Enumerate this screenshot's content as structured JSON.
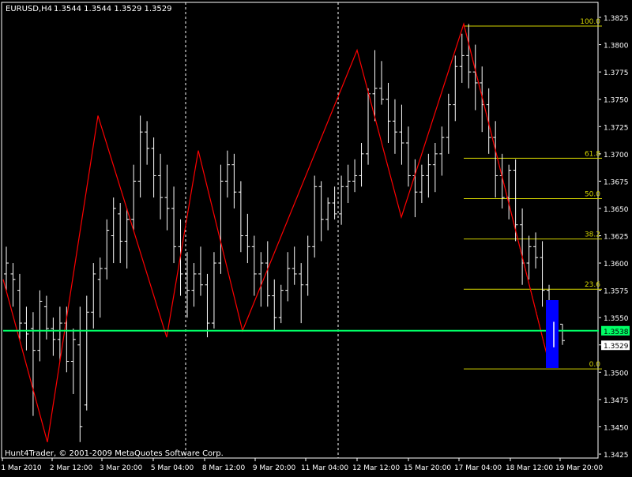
{
  "header": {
    "symbol_timeframe": "EURUSD,H4",
    "ohlc": "1.3544 1.3544 1.3529 1.3529"
  },
  "footer": {
    "copyright": "Hunt4Trader, © 2001-2009 MetaQuotes Software Corp."
  },
  "colors": {
    "background": "#000000",
    "frame": "#ffffff",
    "candle": "#ffffff",
    "zigzag": "#ff0000",
    "fib": "#d4d400",
    "hline": "#00ff66",
    "session_separator": "#ffffff",
    "blue_box": "#0000ff"
  },
  "chart_data": {
    "type": "candlestick",
    "symbol": "EURUSD",
    "timeframe": "H4",
    "ylim": [
      1.342,
      1.3835
    ],
    "y_ticks": [
      "1.3825",
      "1.3800",
      "1.3775",
      "1.3750",
      "1.3725",
      "1.3700",
      "1.3675",
      "1.3650",
      "1.3625",
      "1.3600",
      "1.3575",
      "1.3550",
      "1.3525",
      "1.3500",
      "1.3475",
      "1.3450",
      "1.3425"
    ],
    "x_ticks": [
      "1 Mar 2010",
      "2 Mar 12:00",
      "3 Mar 20:00",
      "5 Mar 04:00",
      "8 Mar 12:00",
      "9 Mar 20:00",
      "11 Mar 04:00",
      "12 Mar 12:00",
      "15 Mar 20:00",
      "17 Mar 04:00",
      "18 Mar 12:00",
      "19 Mar 20:00"
    ],
    "session_separators": [
      "5 Mar 04:00",
      "11 Mar 04:00"
    ],
    "current_price": {
      "label": "1.3538",
      "value": 1.3538
    },
    "bid_price": {
      "label": "1.3529",
      "value": 1.3529
    },
    "fibonacci": {
      "levels": [
        {
          "label": "100.0",
          "price": 1.3817
        },
        {
          "label": "61.8",
          "price": 1.3696
        },
        {
          "label": "50.0",
          "price": 1.3659
        },
        {
          "label": "38.2",
          "price": 1.3622
        },
        {
          "label": "23.6",
          "price": 1.3576
        },
        {
          "label": "0.0",
          "price": 1.3503
        }
      ]
    },
    "zigzag": [
      {
        "t": "1 Mar 2010",
        "price": 1.3585
      },
      {
        "t": "2 Mar 04:00",
        "price": 1.3436
      },
      {
        "t": "3 Mar 04:00",
        "price": 1.3735
      },
      {
        "t": "4 Mar 20:00",
        "price": 1.3532
      },
      {
        "t": "5 Mar 12:00",
        "price": 1.3703
      },
      {
        "t": "8 Mar 20:00",
        "price": 1.3538
      },
      {
        "t": "11 Mar 20:00",
        "price": 1.3795
      },
      {
        "t": "15 Mar 04:00",
        "price": 1.3642
      },
      {
        "t": "17 Mar 04:00",
        "price": 1.3819
      },
      {
        "t": "19 Mar 04:00",
        "price": 1.3505
      }
    ],
    "candles": [
      {
        "o": 1.359,
        "h": 1.3615,
        "l": 1.3575,
        "c": 1.36
      },
      {
        "o": 1.359,
        "h": 1.36,
        "l": 1.356,
        "c": 1.3585
      },
      {
        "o": 1.3575,
        "h": 1.359,
        "l": 1.353,
        "c": 1.3545
      },
      {
        "o": 1.3545,
        "h": 1.356,
        "l": 1.352,
        "c": 1.3535
      },
      {
        "o": 1.354,
        "h": 1.3555,
        "l": 1.346,
        "c": 1.352
      },
      {
        "o": 1.352,
        "h": 1.3575,
        "l": 1.351,
        "c": 1.3565
      },
      {
        "o": 1.356,
        "h": 1.357,
        "l": 1.353,
        "c": 1.354
      },
      {
        "o": 1.354,
        "h": 1.355,
        "l": 1.3515,
        "c": 1.353
      },
      {
        "o": 1.353,
        "h": 1.356,
        "l": 1.351,
        "c": 1.3545
      },
      {
        "o": 1.3545,
        "h": 1.356,
        "l": 1.35,
        "c": 1.351
      },
      {
        "o": 1.351,
        "h": 1.354,
        "l": 1.348,
        "c": 1.353
      },
      {
        "o": 1.3525,
        "h": 1.356,
        "l": 1.3436,
        "c": 1.345
      },
      {
        "o": 1.347,
        "h": 1.357,
        "l": 1.3465,
        "c": 1.3555
      },
      {
        "o": 1.3555,
        "h": 1.36,
        "l": 1.354,
        "c": 1.359
      },
      {
        "o": 1.3585,
        "h": 1.3605,
        "l": 1.355,
        "c": 1.3595
      },
      {
        "o": 1.3595,
        "h": 1.364,
        "l": 1.3585,
        "c": 1.363
      },
      {
        "o": 1.3625,
        "h": 1.366,
        "l": 1.36,
        "c": 1.365
      },
      {
        "o": 1.3645,
        "h": 1.3655,
        "l": 1.36,
        "c": 1.362
      },
      {
        "o": 1.362,
        "h": 1.365,
        "l": 1.3595,
        "c": 1.364
      },
      {
        "o": 1.364,
        "h": 1.369,
        "l": 1.363,
        "c": 1.3675
      },
      {
        "o": 1.3675,
        "h": 1.3735,
        "l": 1.366,
        "c": 1.372
      },
      {
        "o": 1.372,
        "h": 1.373,
        "l": 1.369,
        "c": 1.3705
      },
      {
        "o": 1.3705,
        "h": 1.3715,
        "l": 1.366,
        "c": 1.368
      },
      {
        "o": 1.368,
        "h": 1.37,
        "l": 1.364,
        "c": 1.366
      },
      {
        "o": 1.366,
        "h": 1.369,
        "l": 1.363,
        "c": 1.365
      },
      {
        "o": 1.365,
        "h": 1.367,
        "l": 1.36,
        "c": 1.3615
      },
      {
        "o": 1.3615,
        "h": 1.364,
        "l": 1.357,
        "c": 1.359
      },
      {
        "o": 1.359,
        "h": 1.361,
        "l": 1.355,
        "c": 1.3575
      },
      {
        "o": 1.3575,
        "h": 1.36,
        "l": 1.356,
        "c": 1.359
      },
      {
        "o": 1.359,
        "h": 1.3615,
        "l": 1.357,
        "c": 1.358
      },
      {
        "o": 1.358,
        "h": 1.359,
        "l": 1.3532,
        "c": 1.3545
      },
      {
        "o": 1.3545,
        "h": 1.361,
        "l": 1.354,
        "c": 1.36
      },
      {
        "o": 1.36,
        "h": 1.369,
        "l": 1.359,
        "c": 1.3675
      },
      {
        "o": 1.3675,
        "h": 1.3703,
        "l": 1.366,
        "c": 1.369
      },
      {
        "o": 1.369,
        "h": 1.37,
        "l": 1.365,
        "c": 1.3665
      },
      {
        "o": 1.3665,
        "h": 1.3675,
        "l": 1.361,
        "c": 1.3625
      },
      {
        "o": 1.3625,
        "h": 1.3645,
        "l": 1.36,
        "c": 1.3615
      },
      {
        "o": 1.3615,
        "h": 1.3625,
        "l": 1.357,
        "c": 1.359
      },
      {
        "o": 1.359,
        "h": 1.361,
        "l": 1.356,
        "c": 1.36
      },
      {
        "o": 1.36,
        "h": 1.362,
        "l": 1.356,
        "c": 1.357
      },
      {
        "o": 1.357,
        "h": 1.3585,
        "l": 1.3538,
        "c": 1.355
      },
      {
        "o": 1.355,
        "h": 1.358,
        "l": 1.3545,
        "c": 1.3575
      },
      {
        "o": 1.3575,
        "h": 1.361,
        "l": 1.3565,
        "c": 1.3595
      },
      {
        "o": 1.3595,
        "h": 1.3615,
        "l": 1.358,
        "c": 1.359
      },
      {
        "o": 1.359,
        "h": 1.36,
        "l": 1.3545,
        "c": 1.358
      },
      {
        "o": 1.358,
        "h": 1.3625,
        "l": 1.357,
        "c": 1.3615
      },
      {
        "o": 1.3615,
        "h": 1.368,
        "l": 1.3605,
        "c": 1.367
      },
      {
        "o": 1.367,
        "h": 1.3675,
        "l": 1.362,
        "c": 1.364
      },
      {
        "o": 1.364,
        "h": 1.366,
        "l": 1.363,
        "c": 1.3655
      },
      {
        "o": 1.3655,
        "h": 1.367,
        "l": 1.364,
        "c": 1.3645
      },
      {
        "o": 1.3645,
        "h": 1.368,
        "l": 1.3635,
        "c": 1.367
      },
      {
        "o": 1.367,
        "h": 1.369,
        "l": 1.3655,
        "c": 1.3675
      },
      {
        "o": 1.3675,
        "h": 1.3695,
        "l": 1.3665,
        "c": 1.368
      },
      {
        "o": 1.368,
        "h": 1.371,
        "l": 1.367,
        "c": 1.37
      },
      {
        "o": 1.37,
        "h": 1.376,
        "l": 1.369,
        "c": 1.3755
      },
      {
        "o": 1.3755,
        "h": 1.3795,
        "l": 1.373,
        "c": 1.376
      },
      {
        "o": 1.376,
        "h": 1.3785,
        "l": 1.3745,
        "c": 1.375
      },
      {
        "o": 1.375,
        "h": 1.3765,
        "l": 1.371,
        "c": 1.373
      },
      {
        "o": 1.373,
        "h": 1.375,
        "l": 1.37,
        "c": 1.372
      },
      {
        "o": 1.372,
        "h": 1.3745,
        "l": 1.369,
        "c": 1.371
      },
      {
        "o": 1.371,
        "h": 1.3725,
        "l": 1.367,
        "c": 1.368
      },
      {
        "o": 1.368,
        "h": 1.3695,
        "l": 1.3642,
        "c": 1.3665
      },
      {
        "o": 1.3665,
        "h": 1.369,
        "l": 1.3655,
        "c": 1.368
      },
      {
        "o": 1.368,
        "h": 1.37,
        "l": 1.366,
        "c": 1.369
      },
      {
        "o": 1.369,
        "h": 1.371,
        "l": 1.3665,
        "c": 1.37
      },
      {
        "o": 1.37,
        "h": 1.3725,
        "l": 1.368,
        "c": 1.3715
      },
      {
        "o": 1.3715,
        "h": 1.3755,
        "l": 1.37,
        "c": 1.3745
      },
      {
        "o": 1.3745,
        "h": 1.379,
        "l": 1.373,
        "c": 1.378
      },
      {
        "o": 1.378,
        "h": 1.381,
        "l": 1.3765,
        "c": 1.379
      },
      {
        "o": 1.379,
        "h": 1.3819,
        "l": 1.376,
        "c": 1.3775
      },
      {
        "o": 1.3775,
        "h": 1.38,
        "l": 1.374,
        "c": 1.3765
      },
      {
        "o": 1.3765,
        "h": 1.378,
        "l": 1.372,
        "c": 1.3745
      },
      {
        "o": 1.3745,
        "h": 1.376,
        "l": 1.37,
        "c": 1.3715
      },
      {
        "o": 1.3715,
        "h": 1.373,
        "l": 1.366,
        "c": 1.368
      },
      {
        "o": 1.368,
        "h": 1.37,
        "l": 1.365,
        "c": 1.366
      },
      {
        "o": 1.366,
        "h": 1.369,
        "l": 1.364,
        "c": 1.3685
      },
      {
        "o": 1.3685,
        "h": 1.3695,
        "l": 1.362,
        "c": 1.3635
      },
      {
        "o": 1.3635,
        "h": 1.365,
        "l": 1.358,
        "c": 1.36
      },
      {
        "o": 1.36,
        "h": 1.3625,
        "l": 1.3585,
        "c": 1.3615
      },
      {
        "o": 1.3615,
        "h": 1.3628,
        "l": 1.3595,
        "c": 1.3605
      },
      {
        "o": 1.3605,
        "h": 1.362,
        "l": 1.356,
        "c": 1.3575
      },
      {
        "o": 1.3575,
        "h": 1.358,
        "l": 1.3505,
        "c": 1.352
      },
      {
        "o": 1.352,
        "h": 1.355,
        "l": 1.3505,
        "c": 1.3544
      },
      {
        "o": 1.3544,
        "h": 1.3544,
        "l": 1.3525,
        "c": 1.3529
      }
    ]
  }
}
